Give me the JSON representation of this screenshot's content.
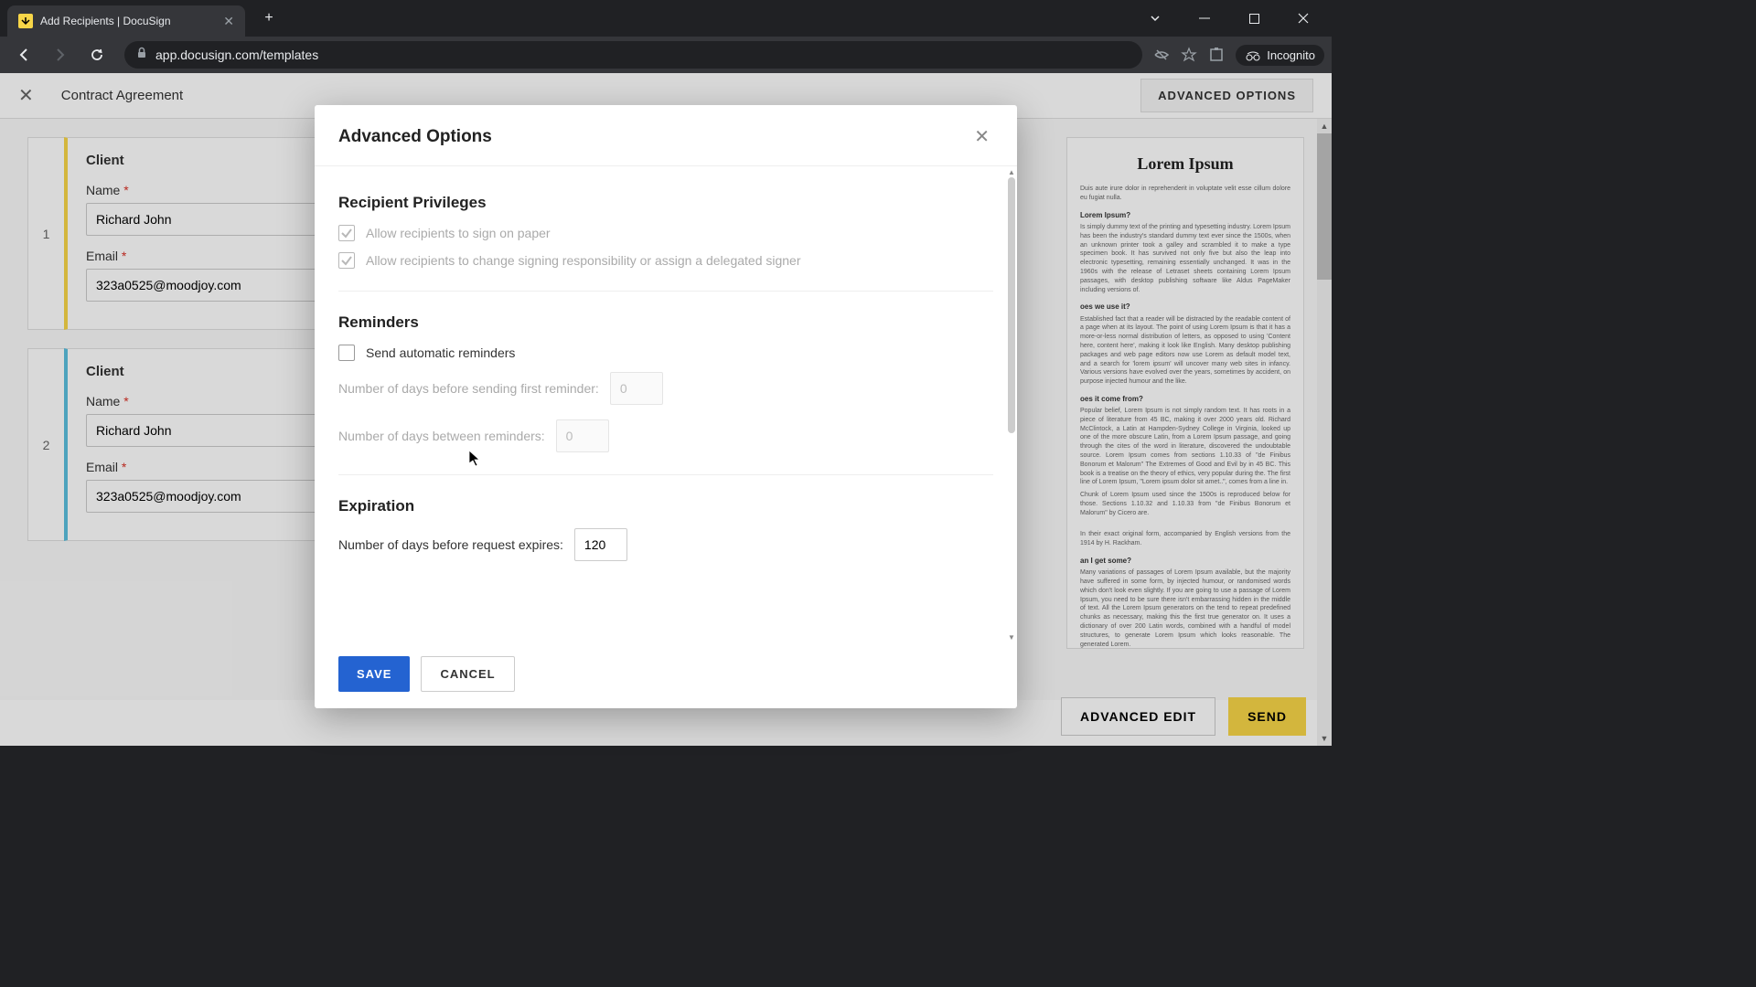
{
  "browser": {
    "tab_title": "Add Recipients | DocuSign",
    "url": "app.docusign.com/templates",
    "incognito_label": "Incognito"
  },
  "page": {
    "title": "Contract Agreement",
    "advanced_options_button": "ADVANCED OPTIONS",
    "advanced_edit_button": "ADVANCED EDIT",
    "send_button": "SEND"
  },
  "recipients": [
    {
      "number": "1",
      "role": "Client",
      "name_label": "Name",
      "name_value": "Richard John",
      "email_label": "Email",
      "email_value": "323a0525@moodjoy.com"
    },
    {
      "number": "2",
      "role": "Client",
      "name_label": "Name",
      "name_value": "Richard John",
      "email_label": "Email",
      "email_value": "323a0525@moodjoy.com"
    }
  ],
  "preview": {
    "title": "Lorem Ipsum",
    "h1": "Lorem Ipsum?",
    "h2": "oes we use it?",
    "h3": "oes it come from?",
    "h4": "an I get some?"
  },
  "modal": {
    "title": "Advanced Options",
    "sections": {
      "privileges": {
        "title": "Recipient Privileges",
        "sign_paper": "Allow recipients to sign on paper",
        "change_signing": "Allow recipients to change signing responsibility or assign a delegated signer"
      },
      "reminders": {
        "title": "Reminders",
        "auto_label": "Send automatic reminders",
        "first_reminder_label": "Number of days before sending first reminder:",
        "first_reminder_value": "0",
        "between_reminders_label": "Number of days between reminders:",
        "between_reminders_value": "0"
      },
      "expiration": {
        "title": "Expiration",
        "expires_label": "Number of days before request expires:",
        "expires_value": "120"
      }
    },
    "save": "SAVE",
    "cancel": "CANCEL"
  }
}
